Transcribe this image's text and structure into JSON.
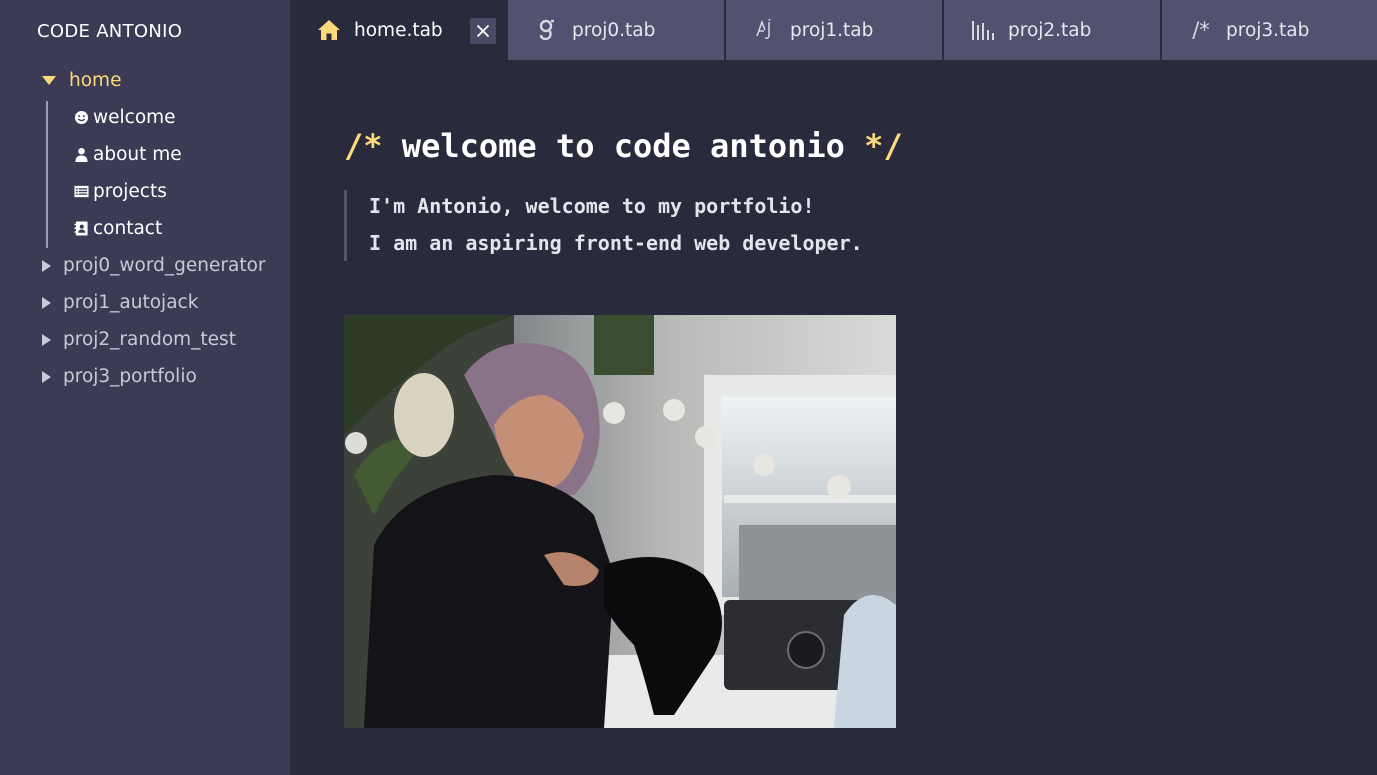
{
  "app": {
    "brand": "CODE ANTONIO"
  },
  "sidebar": {
    "root": {
      "label": "home",
      "expanded": true
    },
    "children": [
      {
        "label": "welcome",
        "icon": "smile-icon"
      },
      {
        "label": "about me",
        "icon": "user-icon"
      },
      {
        "label": "projects",
        "icon": "list-icon"
      },
      {
        "label": "contact",
        "icon": "contact-card-icon"
      }
    ],
    "folders": [
      {
        "label": "proj0_word_generator"
      },
      {
        "label": "proj1_autojack"
      },
      {
        "label": "proj2_random_test"
      },
      {
        "label": "proj3_portfolio"
      }
    ]
  },
  "tabs": [
    {
      "label": "home.tab",
      "icon": "home-icon",
      "active": true
    },
    {
      "label": "proj0.tab",
      "icon": "letter-g-icon",
      "active": false
    },
    {
      "label": "proj1.tab",
      "icon": "aj-icon",
      "active": false
    },
    {
      "label": "proj2.tab",
      "icon": "bars-icon",
      "active": false
    },
    {
      "label": "proj3.tab",
      "icon": "comment-icon",
      "icon_text": "/*",
      "active": false
    }
  ],
  "main": {
    "title_open": "/*",
    "title": "welcome to code antonio",
    "title_close": "*/",
    "intro_line1": "I'm Antonio, welcome to my portfolio!",
    "intro_line2": "I am an aspiring front-end web developer."
  },
  "colors": {
    "accent": "#fcd97a",
    "sidebar_bg": "#3b3b55",
    "main_bg": "#2a2a3d",
    "tab_bg": "#515170"
  }
}
